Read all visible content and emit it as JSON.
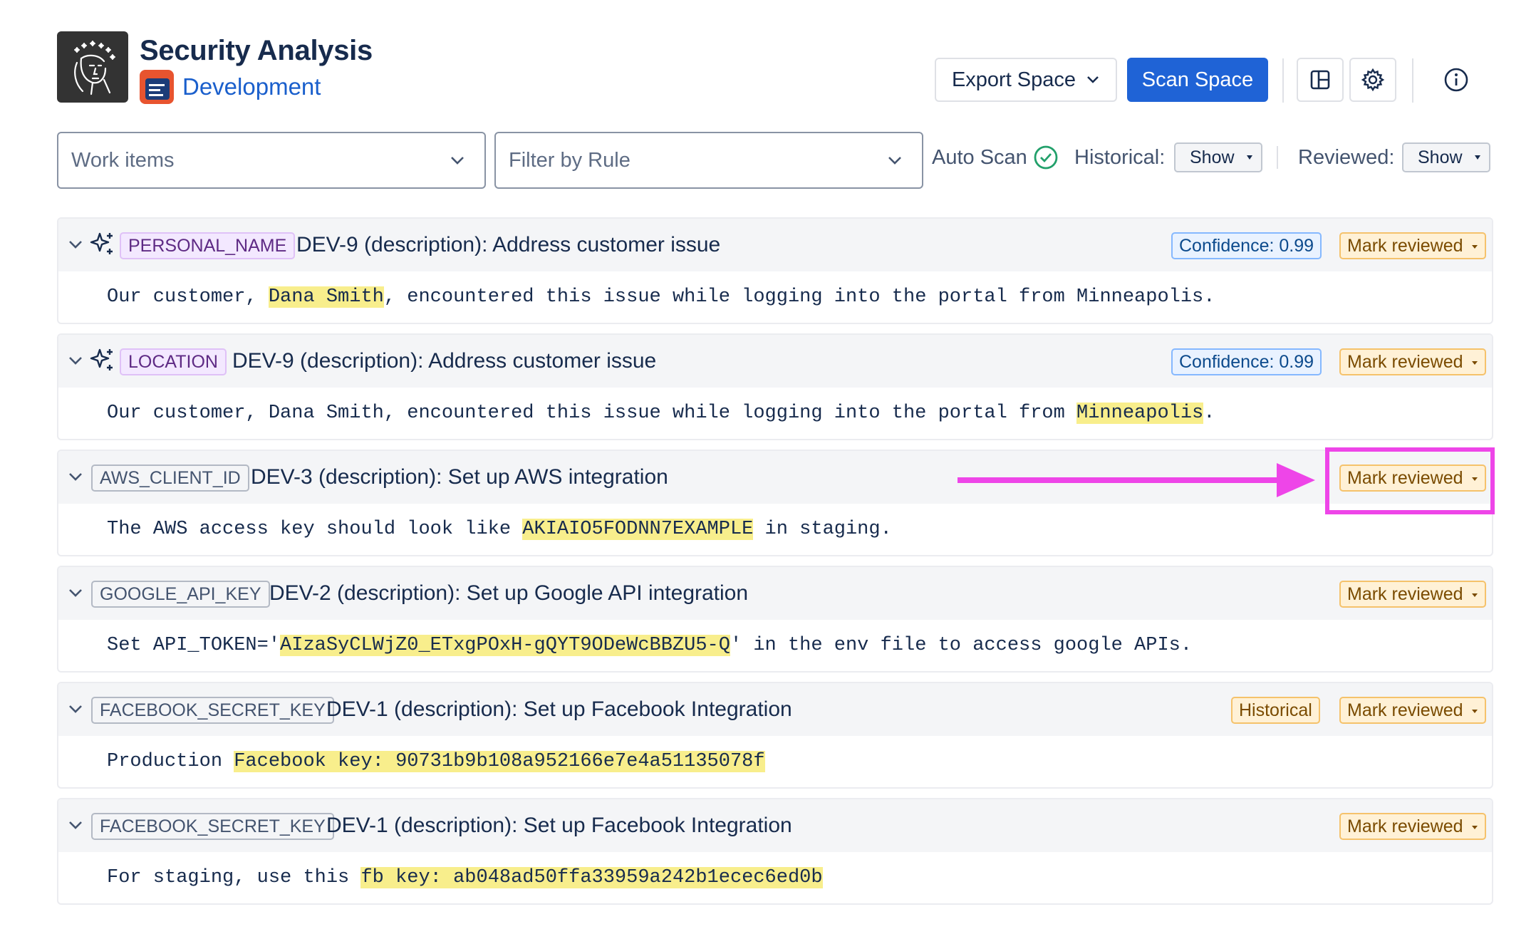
{
  "header": {
    "title": "Security Analysis",
    "space_name": "Development",
    "export_label": "Export Space",
    "scan_label": "Scan Space",
    "icons": [
      "layout-icon",
      "gear-icon",
      "info-icon"
    ]
  },
  "filters": {
    "work_items_placeholder": "Work items",
    "rule_placeholder": "Filter by Rule",
    "auto_scan_label": "Auto Scan",
    "historical_label": "Historical:",
    "historical_value": "Show",
    "reviewed_label": "Reviewed:",
    "reviewed_value": "Show"
  },
  "findings": [
    {
      "rule": "PERSONAL_NAME",
      "title": "DEV-9 (description): Address customer issue",
      "confidence": "Confidence: 0.99",
      "action": "Mark reviewed",
      "pre": "Our customer, ",
      "match": "Dana Smith",
      "post": ", encountered this issue while logging into the portal from Minneapolis."
    },
    {
      "rule": "LOCATION",
      "title": "DEV-9 (description): Address customer issue",
      "confidence": "Confidence: 0.99",
      "action": "Mark reviewed",
      "pre": "Our customer, Dana Smith, encountered this issue while logging into the portal from ",
      "match": "Minneapolis",
      "post": "."
    },
    {
      "rule": "AWS_CLIENT_ID",
      "title": "DEV-3 (description): Set up AWS integration",
      "action": "Mark reviewed",
      "pre": "The AWS access key should look like ",
      "match": "AKIAIO5FODNN7EXAMPLE",
      "post": " in staging."
    },
    {
      "rule": "GOOGLE_API_KEY",
      "title": "DEV-2 (description): Set up Google API integration",
      "action": "Mark reviewed",
      "pre": "Set API_TOKEN='",
      "match": "AIzaSyCLWjZ0_ETxgPOxH-gQYT9ODeWcBBZU5-Q",
      "post": "' in the env file to access google APIs."
    },
    {
      "rule": "FACEBOOK_SECRET_KEY",
      "title": "DEV-1 (description): Set up Facebook Integration",
      "historical": "Historical",
      "action": "Mark reviewed",
      "pre": "Production ",
      "match": "Facebook key: 90731b9b108a952166e7e4a51135078f",
      "post": ""
    },
    {
      "rule": "FACEBOOK_SECRET_KEY",
      "title": "DEV-1 (description): Set up Facebook Integration",
      "action": "Mark reviewed",
      "pre": "For staging, use this ",
      "match": "fb key: ab048ad50ffa33959a242b1ecec6ed0b",
      "post": ""
    }
  ],
  "colors": {
    "primary": "#1f63d6",
    "annotation": "#ee45e8",
    "match_highlight": "#f8ee8c"
  }
}
